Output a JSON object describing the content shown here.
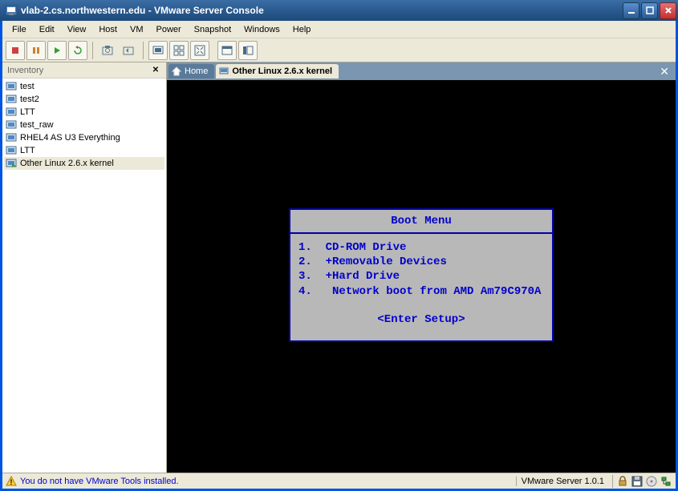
{
  "title": "vlab-2.cs.northwestern.edu - VMware Server Console",
  "menu": [
    "File",
    "Edit",
    "View",
    "Host",
    "VM",
    "Power",
    "Snapshot",
    "Windows",
    "Help"
  ],
  "sidebar": {
    "title": "Inventory",
    "items": [
      {
        "label": "test",
        "selected": false
      },
      {
        "label": "test2",
        "selected": false
      },
      {
        "label": "LTT",
        "selected": false
      },
      {
        "label": "test_raw",
        "selected": false
      },
      {
        "label": "RHEL4 AS U3 Everything",
        "selected": false
      },
      {
        "label": "LTT",
        "selected": false
      },
      {
        "label": "Other Linux 2.6.x kernel",
        "selected": true
      }
    ]
  },
  "tabs": {
    "home": "Home",
    "active": "Other Linux 2.6.x kernel"
  },
  "boot": {
    "title": "Boot Menu",
    "items": [
      {
        "n": "1.",
        "label": "  CD-ROM Drive"
      },
      {
        "n": "2.",
        "label": "  +Removable Devices"
      },
      {
        "n": "3.",
        "label": "  +Hard Drive"
      },
      {
        "n": "4.",
        "label": "   Network boot from AMD Am79C970A"
      }
    ],
    "setup": "<Enter Setup>"
  },
  "status": {
    "warning": "You do not have VMware Tools installed.",
    "version": "VMware Server 1.0.1"
  }
}
